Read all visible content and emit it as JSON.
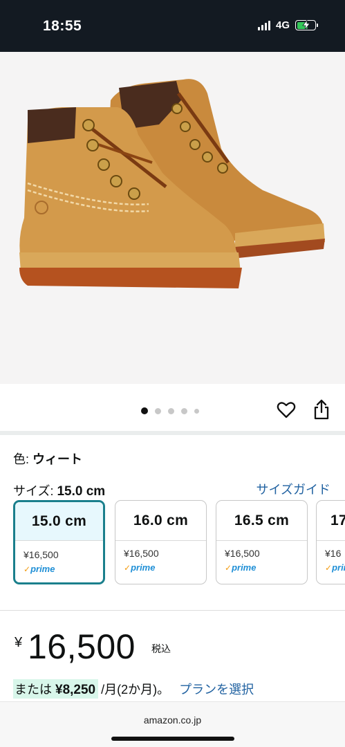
{
  "status_bar": {
    "time": "18:55",
    "network": "4G"
  },
  "product_image": {
    "subject": "boots-image",
    "carousel_total": 5,
    "carousel_active": 1
  },
  "product": {
    "color_label": "色: ",
    "color_value": "ウィート",
    "size_label": "サイズ: ",
    "size_value": "15.0 cm",
    "size_guide": "サイズガイド",
    "size_options": [
      {
        "size": "15.0 cm",
        "price": "¥16,500",
        "prime": "prime",
        "selected": true
      },
      {
        "size": "16.0 cm",
        "price": "¥16,500",
        "prime": "prime",
        "selected": false
      },
      {
        "size": "16.5 cm",
        "price": "¥16,500",
        "prime": "prime",
        "selected": false
      },
      {
        "size": "17",
        "price": "¥16",
        "prime": "prim",
        "selected": false
      }
    ]
  },
  "price": {
    "currency": "¥",
    "amount": "16,500",
    "tax_note": "税込",
    "installment_prefix": "または",
    "installment_amount": "¥8,250",
    "installment_suffix": "/月(2か月)。",
    "plan_link": "プランを選択"
  },
  "browser": {
    "domain": "amazon.co.jp"
  },
  "colors": {
    "status_bar_bg": "#131a22",
    "link": "#2162a1",
    "selected_border": "#1a7f8c",
    "selected_bg": "#e7f8fd",
    "installment_highlight": "#d8f6ea",
    "prime_blue": "#1f8fd6",
    "battery_green": "#34c759"
  },
  "icons": {
    "heart": "heart-icon",
    "share": "share-icon",
    "signal": "signal-icon",
    "battery": "battery-icon",
    "prime_check": "prime-check-icon"
  }
}
